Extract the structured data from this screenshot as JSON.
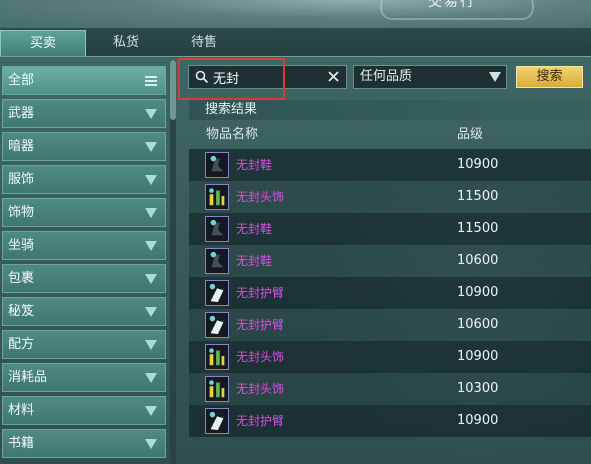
{
  "window": {
    "title": "交易行"
  },
  "tabs": [
    {
      "label": "买卖",
      "active": true
    },
    {
      "label": "私货",
      "active": false
    },
    {
      "label": "待售",
      "active": false
    }
  ],
  "sidebar": {
    "items": [
      {
        "label": "全部",
        "icon": "menu-icon",
        "selected": true
      },
      {
        "label": "武器",
        "icon": "chevron-down-icon"
      },
      {
        "label": "暗器",
        "icon": "chevron-down-icon"
      },
      {
        "label": "服饰",
        "icon": "chevron-down-icon"
      },
      {
        "label": "饰物",
        "icon": "chevron-down-icon"
      },
      {
        "label": "坐骑",
        "icon": "chevron-down-icon"
      },
      {
        "label": "包裹",
        "icon": "chevron-down-icon"
      },
      {
        "label": "秘笈",
        "icon": "chevron-down-icon"
      },
      {
        "label": "配方",
        "icon": "chevron-down-icon"
      },
      {
        "label": "消耗品",
        "icon": "chevron-down-icon"
      },
      {
        "label": "材料",
        "icon": "chevron-down-icon"
      },
      {
        "label": "书籍",
        "icon": "chevron-down-icon"
      }
    ]
  },
  "search": {
    "value": "无封",
    "quality_select": "任何品质",
    "button_label": "搜索"
  },
  "results": {
    "title": "搜索结果",
    "columns": {
      "name": "物品名称",
      "level": "品级"
    },
    "rows": [
      {
        "name": "无封鞋",
        "level": "10900",
        "icon": "boots-icon"
      },
      {
        "name": "无封头饰",
        "level": "11500",
        "icon": "headgear-icon"
      },
      {
        "name": "无封鞋",
        "level": "11500",
        "icon": "boots-icon"
      },
      {
        "name": "无封鞋",
        "level": "10600",
        "icon": "boots-icon"
      },
      {
        "name": "无封护臂",
        "level": "10900",
        "icon": "bracer-icon"
      },
      {
        "name": "无封护臂",
        "level": "10600",
        "icon": "bracer-icon"
      },
      {
        "name": "无封头饰",
        "level": "10900",
        "icon": "headgear-icon"
      },
      {
        "name": "无封头饰",
        "level": "10300",
        "icon": "headgear-icon"
      },
      {
        "name": "无封护臂",
        "level": "10900",
        "icon": "bracer-icon"
      }
    ]
  },
  "colors": {
    "item_name": "#d94ce8",
    "search_button": "#e0b548",
    "highlight": "#d83a3a"
  }
}
